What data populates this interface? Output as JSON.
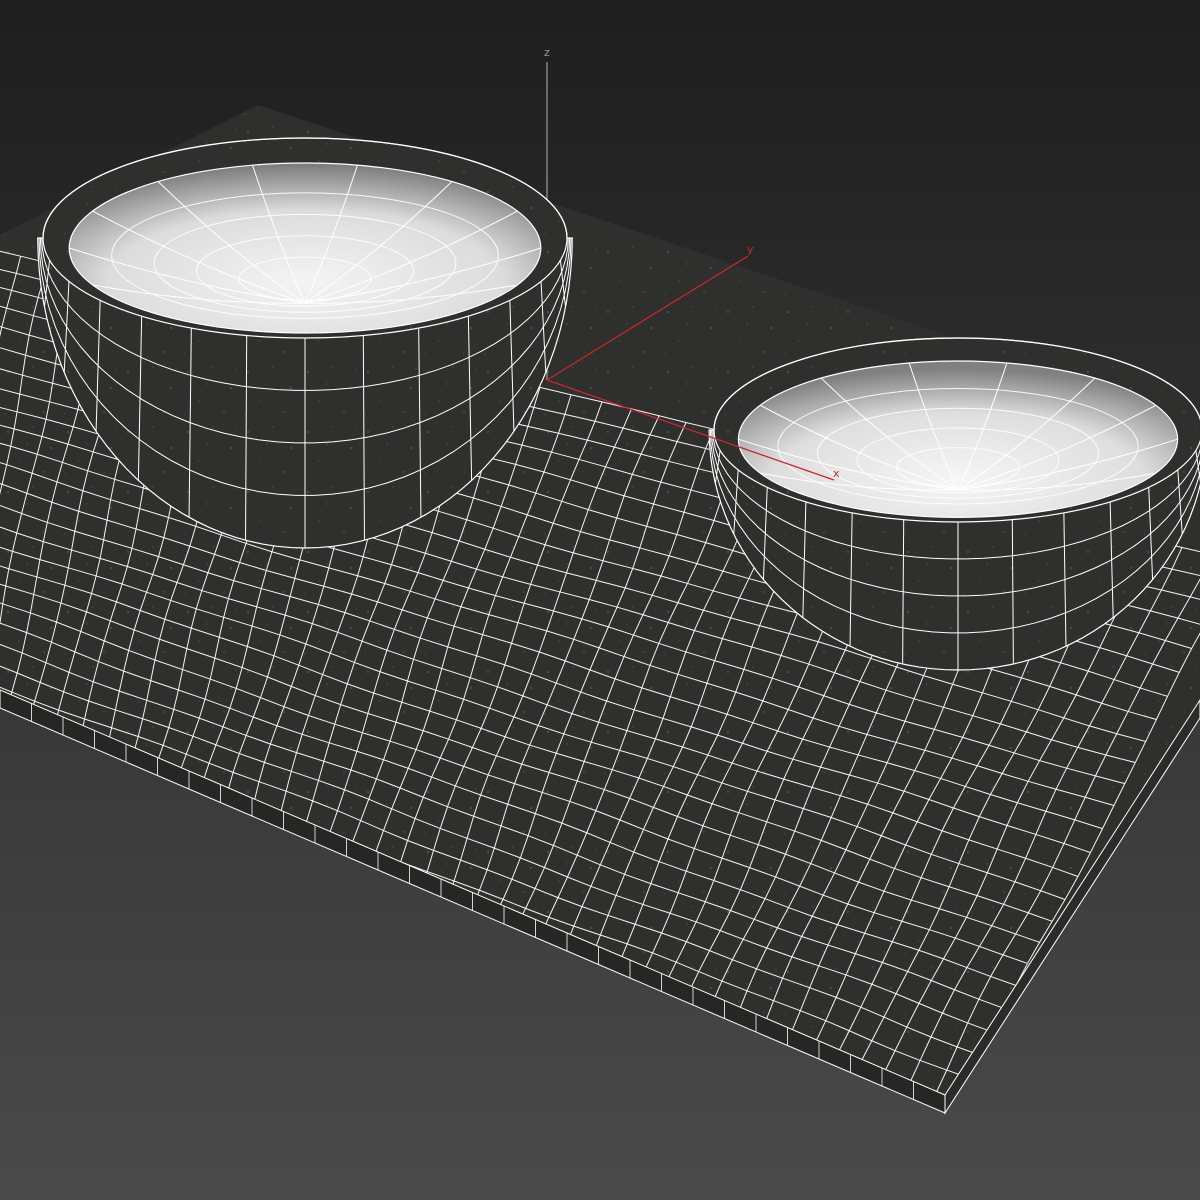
{
  "viewport": {
    "background_top": "#1e1e1e",
    "background_bottom": "#4a4a4a",
    "wire_color": "#ffffff",
    "surface_color": "#2f2f2d",
    "bowl_inner_light": "#f2f2f2",
    "bowl_inner_dark": "#8a8a8a"
  },
  "gizmo": {
    "x_label": "x",
    "y_label": "y",
    "z_label": "z",
    "x_color": "#c8282d",
    "y_color": "#c8282d",
    "z_color": "#9a9a9a"
  },
  "objects": [
    {
      "name": "mat-plane",
      "icon": "plane-mesh"
    },
    {
      "name": "bowl-large",
      "icon": "bowl-mesh"
    },
    {
      "name": "bowl-small",
      "icon": "bowl-mesh"
    }
  ]
}
